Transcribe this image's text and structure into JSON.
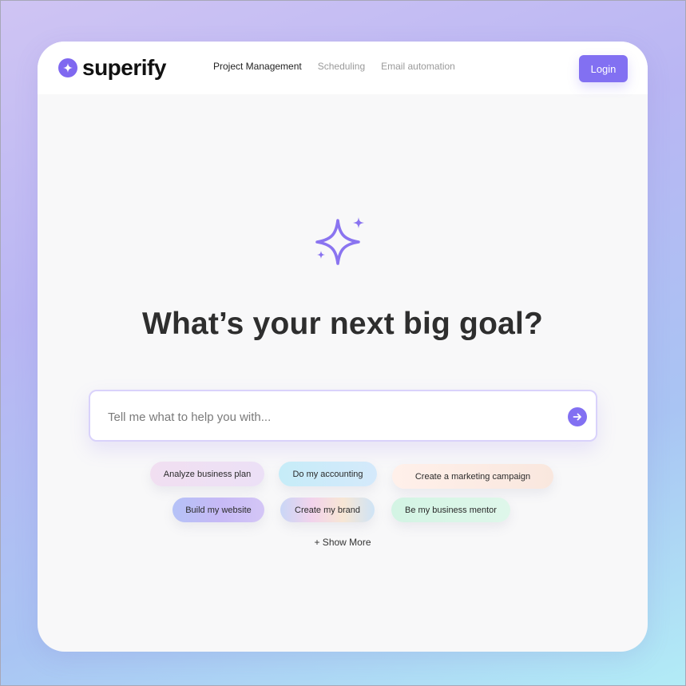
{
  "app": {
    "name": "superify",
    "brand_color": "#8270f2"
  },
  "nav": {
    "items": [
      {
        "label": "Project Management",
        "active": true
      },
      {
        "label": "Scheduling",
        "active": false
      },
      {
        "label": "Email automation",
        "active": false
      }
    ],
    "login_label": "Login"
  },
  "hero": {
    "icon": "sparkle-icon",
    "headline": "What’s your next big goal?"
  },
  "search": {
    "placeholder": "Tell me what to help you with...",
    "value": "",
    "send_icon": "arrow-right-icon"
  },
  "suggestions": [
    {
      "label": "Analyze business plan"
    },
    {
      "label": "Do my accounting"
    },
    {
      "label": "Create a marketing campaign"
    },
    {
      "label": "Build my website"
    },
    {
      "label": "Create my brand"
    },
    {
      "label": "Be my business mentor"
    }
  ],
  "show_more_label": "+ Show More"
}
